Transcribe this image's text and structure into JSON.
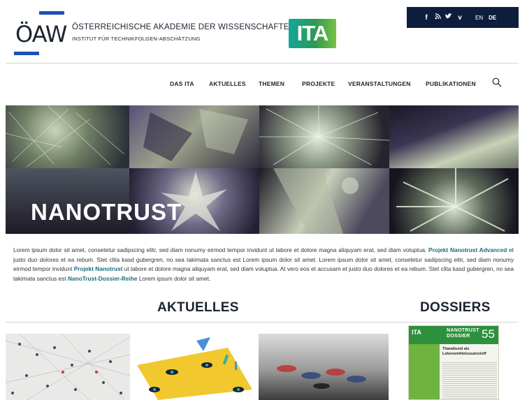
{
  "topbar": {
    "icons": [
      "facebook-icon",
      "rss-icon",
      "twitter-icon",
      "vimeo-icon"
    ],
    "icon_glyphs": [
      "f",
      "≡",
      "♥",
      "v"
    ],
    "lang_en": "EN",
    "lang_de": "DE"
  },
  "logo": {
    "oeaw": "ÖAW",
    "institution": "ÖSTERREICHISCHE AKADEMIE DER WISSENSCHAFTEN",
    "institute": "INSTITUT FÜR TECHNIKFOLGEN-ABSCHÄTZUNG",
    "ita": "ITA"
  },
  "nav": {
    "items": [
      "DAS ITA",
      "AKTUELLES",
      "THEMEN",
      "PROJEKTE",
      "VERANSTALTUNGEN",
      "PUBLIKATIONEN"
    ]
  },
  "hero": {
    "title": "NANOTRUST"
  },
  "intro": {
    "p1": "Lorem ipsum dolor sit amet, consetetur sadipscing elitr, sed diam nonumy eirmod tempor invidunt ut labore et dolore magna aliquyam erat, sed diam voluptua. ",
    "link1": "Projekt Nanotrust Advanced",
    "p2": " et justo duo dolores et ea rebum. Stet clita kasd gubergren, no sea takimata sanctus est Lorem ipsum dolor sit amet. Lorem ipsum dolor sit amet, consetetur sadipscing elitr, sed diam nonumy eirmod tempor invidunt ",
    "link2": "Projekt Nanotrust",
    "p3": " ut labore et dolore magna aliquyam erat, sed diam voluptua. At vero eos et accusam et justo duo dolores et ea rebum. Stet clita kasd gubergren, no sea takimata sanctus est ",
    "link3": "NanoTrust-Dossier-Reihe",
    "p4": " Lorem ipsum dolor sit amet."
  },
  "sections": {
    "news_heading": "AKTUELLES",
    "dossiers_heading": "DOSSIERS"
  },
  "dossier": {
    "brand": "ITA",
    "series": "NANOTRUST DOSSIER",
    "number": "55",
    "title": "Titandioxid als Lebensmittelzusatzstoff"
  },
  "colors": {
    "brand_blue": "#1d4fb8",
    "navy": "#0d1e3d",
    "link_teal": "#1a6d7a",
    "ita_green": "#2c9a52"
  }
}
